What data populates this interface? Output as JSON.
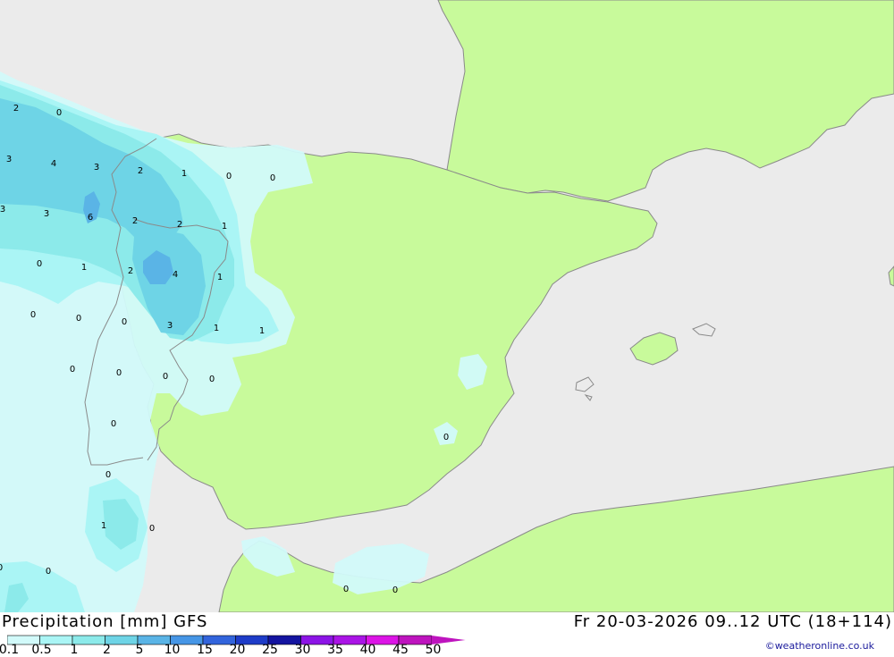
{
  "title": {
    "left": "Precipitation [mm] GFS",
    "right": "Fr 20-03-2026 09..12 UTC (18+114)"
  },
  "credit": "©weatheronline.co.uk",
  "legend": {
    "ticks": [
      "0.1",
      "0.5",
      "1",
      "2",
      "5",
      "10",
      "15",
      "20",
      "25",
      "30",
      "35",
      "40",
      "45",
      "50"
    ],
    "colors": [
      "#d2fafa",
      "#aaf5f5",
      "#8ceaea",
      "#6ed4e6",
      "#5ab4e6",
      "#4696e6",
      "#3264dc",
      "#1e3cc8",
      "#1414a0",
      "#8c14e6",
      "#aa14e6",
      "#dc14e6",
      "#be14be"
    ]
  },
  "map_colors": {
    "sea": "#ebebeb",
    "land": "#c8fa9b",
    "coast": "#8a8a8a"
  },
  "value_labels": [
    "2",
    "0",
    "3",
    "4",
    "3",
    "2",
    "1",
    "0",
    "0",
    "3",
    "3",
    "6",
    "2",
    "2",
    "1",
    "0",
    "1",
    "2",
    "4",
    "1",
    "0",
    "0",
    "0",
    "3",
    "1",
    "1",
    "0",
    "0",
    "0",
    "0",
    "0",
    "0",
    "0",
    "1",
    "0",
    "0",
    "0",
    "0",
    "0"
  ]
}
